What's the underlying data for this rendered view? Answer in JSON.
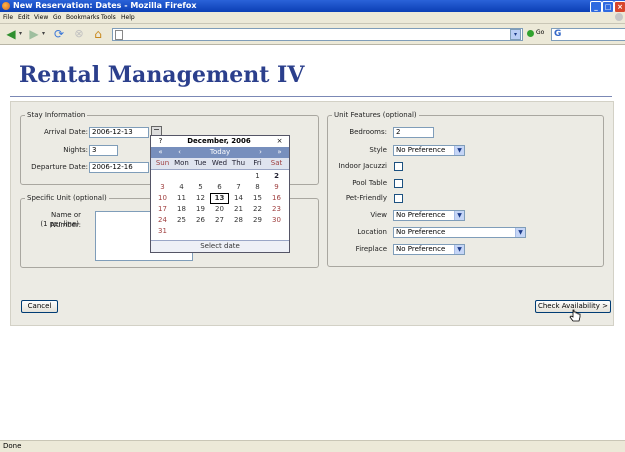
{
  "window": {
    "title": "New Reservation: Dates - Mozilla Firefox",
    "min": "_",
    "max": "□",
    "close": "×"
  },
  "menu": [
    "File",
    "Edit",
    "View",
    "Go",
    "Bookmarks",
    "Tools",
    "Help"
  ],
  "nav": {
    "back_icon": "back-arrow-icon",
    "forward_icon": "forward-arrow-icon",
    "go_label": "Go",
    "search_glyph": "G"
  },
  "page": {
    "title": "Rental Management IV"
  },
  "stay": {
    "legend": "Stay Information",
    "arrival_label": "Arrival Date:",
    "arrival_value": "2006-12-13",
    "nights_label": "Nights:",
    "nights_value": "3",
    "departure_label": "Departure Date:",
    "departure_value": "2006-12-16"
  },
  "specific": {
    "legend": "Specific Unit (optional)",
    "name_label": "Name or Number:",
    "per_line": "(1 per line)"
  },
  "features": {
    "legend": "Unit Features (optional)",
    "bedrooms_label": "Bedrooms:",
    "bedrooms_value": "2",
    "style_label": "Style",
    "style_value": "No Preference",
    "jacuzzi_label": "Indoor Jacuzzi",
    "pool_label": "Pool Table",
    "pet_label": "Pet-Friendly",
    "view_label": "View",
    "view_value": "No Preference",
    "location_label": "Location",
    "location_value": "No Preference",
    "fireplace_label": "Fireplace",
    "fireplace_value": "No Preference"
  },
  "buttons": {
    "cancel": "Cancel",
    "check": "Check Availability >"
  },
  "calendar": {
    "help": "?",
    "month_title": "December, 2006",
    "close": "×",
    "prev_year": "«",
    "prev_month": "‹",
    "today": "Today",
    "next_month": "›",
    "next_year": "»",
    "day_names": [
      "Sun",
      "Mon",
      "Tue",
      "Wed",
      "Thu",
      "Fri",
      "Sat"
    ],
    "weeks": [
      [
        "",
        "",
        "",
        "",
        "",
        "1",
        "2"
      ],
      [
        "3",
        "4",
        "5",
        "6",
        "7",
        "8",
        "9"
      ],
      [
        "10",
        "11",
        "12",
        "13",
        "14",
        "15",
        "16"
      ],
      [
        "17",
        "18",
        "19",
        "20",
        "21",
        "22",
        "23"
      ],
      [
        "24",
        "25",
        "26",
        "27",
        "28",
        "29",
        "30"
      ],
      [
        "31",
        "",
        "",
        "",
        "",
        "",
        ""
      ]
    ],
    "today_day": "13",
    "bold_day": "2",
    "footer": "Select date"
  },
  "status": {
    "text": "Done"
  },
  "colors": {
    "title_blue": "#2b3f8c",
    "calendar_nav": "#778fbd",
    "xp_blue": "#0b3fb5"
  }
}
